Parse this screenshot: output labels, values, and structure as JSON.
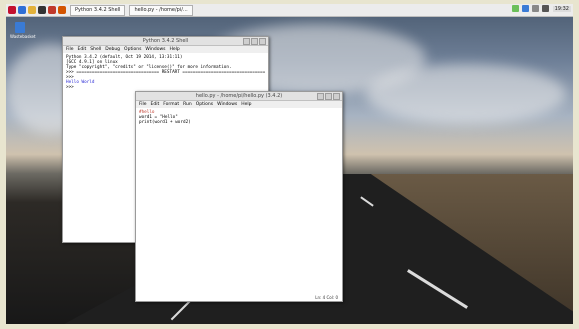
{
  "taskbar": {
    "tasks": [
      "Python 3.4.2 Shell",
      "hello.py - /home/pi/..."
    ],
    "clock": "19:32"
  },
  "desktop": {
    "trash_label": "Wastebasket"
  },
  "shell_window": {
    "title": "Python 3.4.2 Shell",
    "menu": [
      "File",
      "Edit",
      "Shell",
      "Debug",
      "Options",
      "Windows",
      "Help"
    ],
    "lines": [
      "Python 3.4.2 (default, Oct 19 2014, 13:31:11)",
      "[GCC 4.9.1] on linux",
      "Type \"copyright\", \"credits\" or \"license()\" for more information.",
      ">>> ================================ RESTART ================================",
      ">>>",
      "Hello World",
      ">>>"
    ]
  },
  "editor_window": {
    "title": "hello.py - /home/pi/hello.py (3.4.2)",
    "menu": [
      "File",
      "Edit",
      "Format",
      "Run",
      "Options",
      "Windows",
      "Help"
    ],
    "lines": [
      "#hello",
      "word1 = \"Hello\"",
      "print(word1 + word2)"
    ],
    "status": "Ln: 4 Col: 0"
  }
}
